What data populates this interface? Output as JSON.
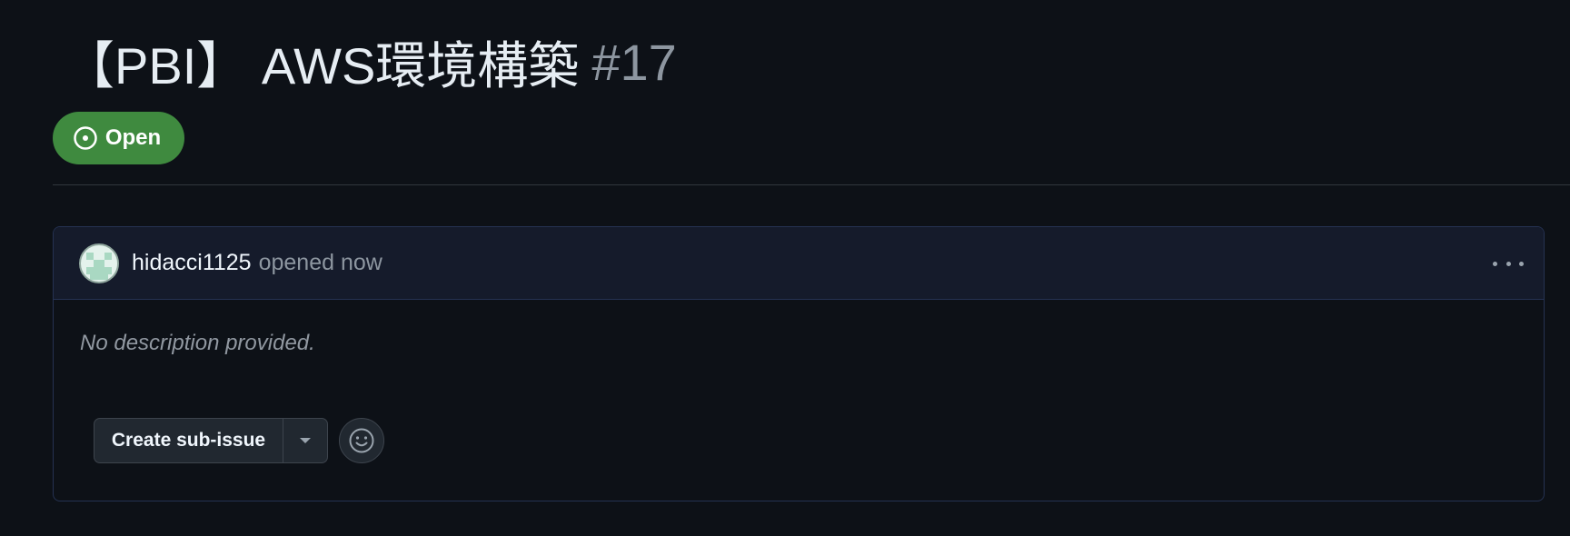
{
  "issue": {
    "title": "【PBI】 AWS環境構築",
    "number": "#17",
    "state": "Open",
    "state_color": "#3f8a3f"
  },
  "comment": {
    "author": "hidacci1125",
    "action": "opened now",
    "body": "No description provided.",
    "menu_icon": "kebab-horizontal-icon"
  },
  "actions": {
    "create_sub_issue_label": "Create sub-issue",
    "dropdown_icon": "triangle-down-icon",
    "reaction_icon": "smiley-icon"
  }
}
